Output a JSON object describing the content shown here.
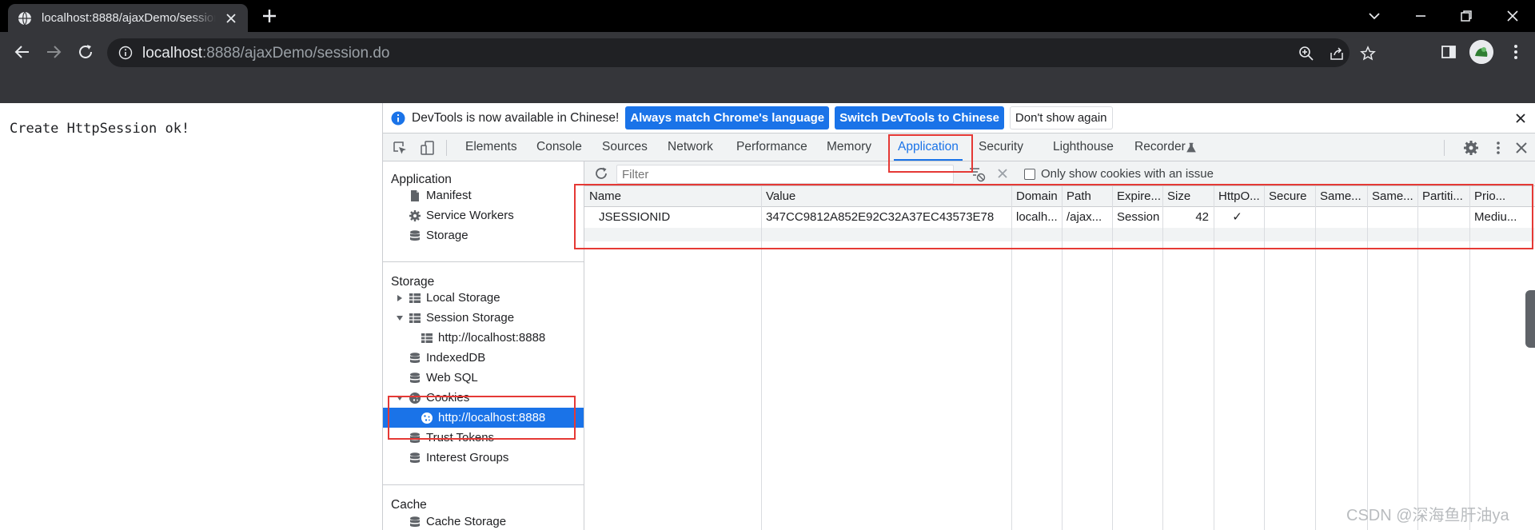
{
  "browser": {
    "tab_title": "localhost:8888/ajaxDemo/session.do",
    "url_host": "localhost",
    "url_rest": ":8888/ajaxDemo/session.do"
  },
  "page": {
    "text": "Create HttpSession ok!"
  },
  "devtools": {
    "infobar": {
      "message": "DevTools is now available in Chinese!",
      "btn_match": "Always match Chrome's language",
      "btn_switch": "Switch DevTools to Chinese",
      "btn_dismiss": "Don't show again"
    },
    "tabs": [
      "Elements",
      "Console",
      "Sources",
      "Network",
      "Performance",
      "Memory",
      "Application",
      "Security",
      "Lighthouse",
      "Recorder"
    ],
    "active_tab": "Application",
    "sidebar": {
      "application_heading": "Application",
      "application_items": [
        "Manifest",
        "Service Workers",
        "Storage"
      ],
      "storage_heading": "Storage",
      "local_storage": "Local Storage",
      "session_storage": "Session Storage",
      "session_origin": "http://localhost:8888",
      "indexeddb": "IndexedDB",
      "websql": "Web SQL",
      "cookies": "Cookies",
      "cookies_origin": "http://localhost:8888",
      "trust_tokens": "Trust Tokens",
      "interest_groups": "Interest Groups",
      "cache_heading": "Cache",
      "cache_storage": "Cache Storage"
    },
    "cookies": {
      "filter_placeholder": "Filter",
      "only_issue_label": "Only show cookies with an issue",
      "columns": [
        "Name",
        "Value",
        "Domain",
        "Path",
        "Expire...",
        "Size",
        "HttpO...",
        "Secure",
        "Same...",
        "Same...",
        "Partiti...",
        "Prio..."
      ],
      "rows": [
        {
          "name": "JSESSIONID",
          "value": "347CC9812A852E92C32A37EC43573E78",
          "domain": "localh...",
          "path": "/ajax...",
          "expires": "Session",
          "size": "42",
          "httponly": "✓",
          "secure": "",
          "samesite": "",
          "sameparty": "",
          "partition": "",
          "priority": "Mediu..."
        }
      ]
    }
  },
  "watermark": "CSDN @深海鱼肝油ya",
  "colors": {
    "accent": "#1a73e8",
    "highlight": "#e53935",
    "chrome_dark": "#35363a"
  }
}
